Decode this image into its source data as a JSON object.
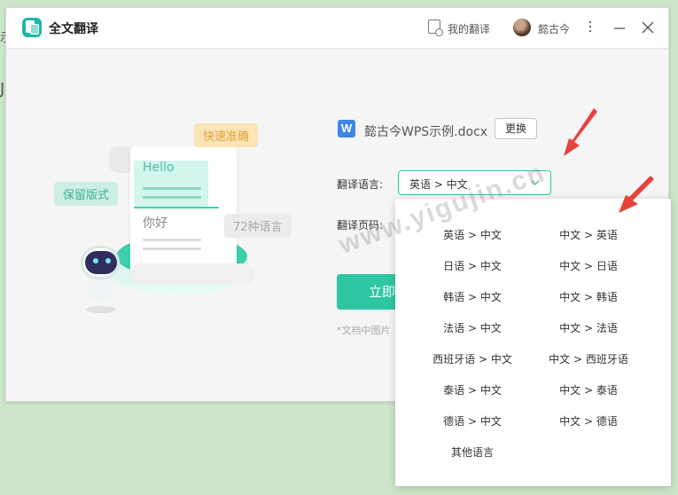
{
  "background": {
    "glyph_top": "示",
    "glyph_mid": "J"
  },
  "titlebar": {
    "app_title": "全文翻译",
    "my_translations": "我的翻译",
    "username": "懿古今"
  },
  "illustration": {
    "tag_fast": "快速准确",
    "tag_format": "保留版式",
    "tag_languages": "72种语言",
    "hello": "Hello",
    "nihao": "你好"
  },
  "panel": {
    "doc_icon_letter": "W",
    "file_name": "懿古今WPS示例.docx",
    "replace_button": "更换",
    "language_label": "翻译语言:",
    "selected_language": "英语 > 中文",
    "pages_label": "翻译页码:",
    "start_button_partial": "立即",
    "note_partial": "*文档中图片"
  },
  "dropdown": {
    "options": [
      "英语 > 中文",
      "中文 > 英语",
      "日语 > 中文",
      "中文 > 日语",
      "韩语 > 中文",
      "中文 > 韩语",
      "法语 > 中文",
      "中文 > 法语",
      "西班牙语 > 中文",
      "中文 > 西班牙语",
      "泰语 > 中文",
      "中文 > 泰语",
      "德语 > 中文",
      "中文 > 德语",
      "其他语言"
    ]
  },
  "watermark": "www.yigujin.cn",
  "colors": {
    "accent": "#2ec7a4",
    "arrow": "#e8423b",
    "background": "#cde6c9"
  }
}
